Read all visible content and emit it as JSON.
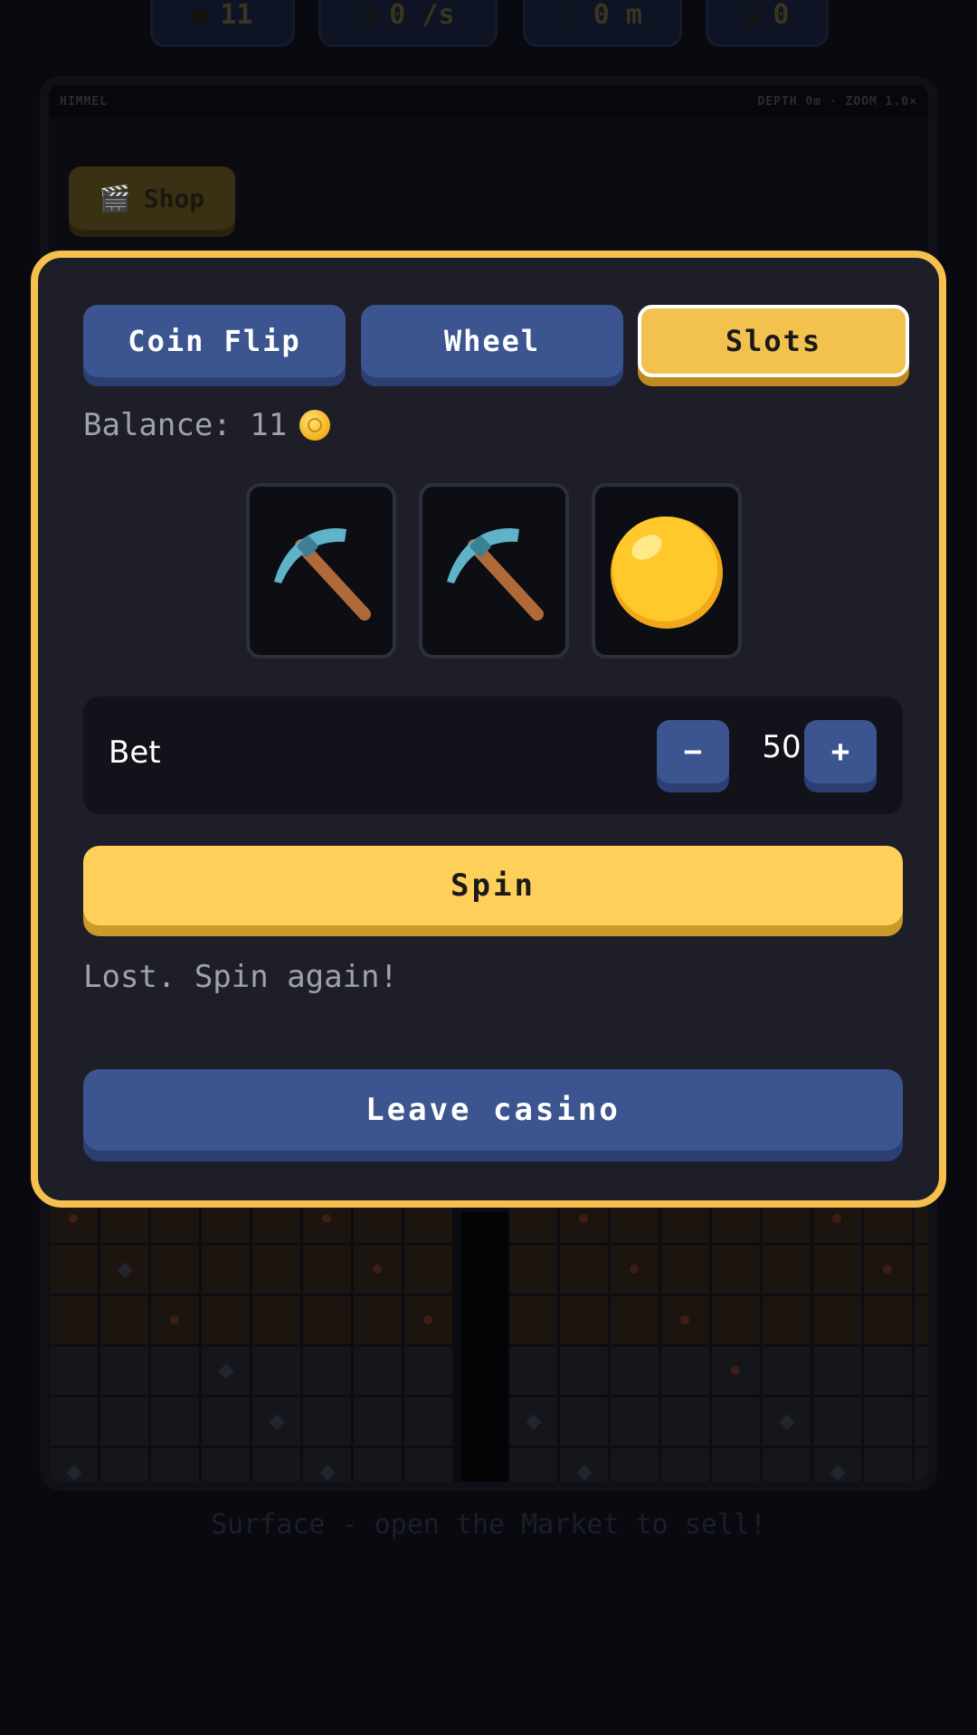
{
  "stats": {
    "coins": "11",
    "rate": "0 /s",
    "depth": "0 m",
    "crowns": "0"
  },
  "hud": {
    "left": "HIMMEL",
    "right": "DEPTH 0m · ZOOM 1.0×"
  },
  "shop": {
    "label": "Shop",
    "icon": "clapper-icon"
  },
  "casino": {
    "tabs": [
      {
        "label": "Coin Flip",
        "active": false
      },
      {
        "label": "Wheel",
        "active": false
      },
      {
        "label": "Slots",
        "active": true
      }
    ],
    "balance_label": "Balance: 11",
    "reels": [
      "pickaxe-icon",
      "pickaxe-icon",
      "coin-icon"
    ],
    "bet": {
      "label": "Bet",
      "value": "50",
      "minus": "−",
      "plus": "+"
    },
    "spin_label": "Spin",
    "result": "Lost. Spin again!",
    "leave_label": "Leave casino"
  },
  "footer": "Surface - open the Market to sell!",
  "colors": {
    "accent_gold": "#f5c04d",
    "button_blue": "#3c5590",
    "panel": "#1e1e29"
  }
}
